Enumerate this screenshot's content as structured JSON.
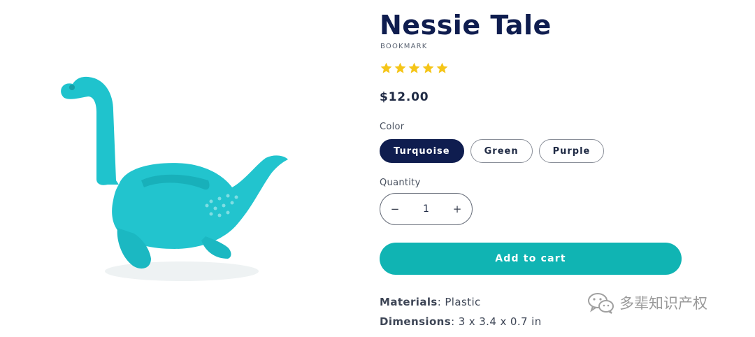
{
  "product": {
    "title": "Nessie Tale",
    "category": "BOOKMARK",
    "rating": 5,
    "rating_max": 5,
    "price": "$12.00",
    "image_icon": "nessie-image",
    "accent_color": "#10b4b3",
    "primary_color": "#0f1d4f",
    "star_color": "#f5c518"
  },
  "options": {
    "color_label": "Color",
    "colors": [
      "Turquoise",
      "Green",
      "Purple"
    ],
    "selected_color": "Turquoise"
  },
  "quantity": {
    "label": "Quantity",
    "value": "1",
    "decrement_symbol": "−",
    "increment_symbol": "+"
  },
  "cart": {
    "add_label": "Add to cart"
  },
  "specs": {
    "materials_key": "Materials",
    "materials_value": "Plastic",
    "dimensions_key": "Dimensions",
    "dimensions_value": "3 x 3.4 x 0.7 in"
  },
  "watermark": {
    "text": "多辈知识产权",
    "icon": "wechat-icon"
  }
}
